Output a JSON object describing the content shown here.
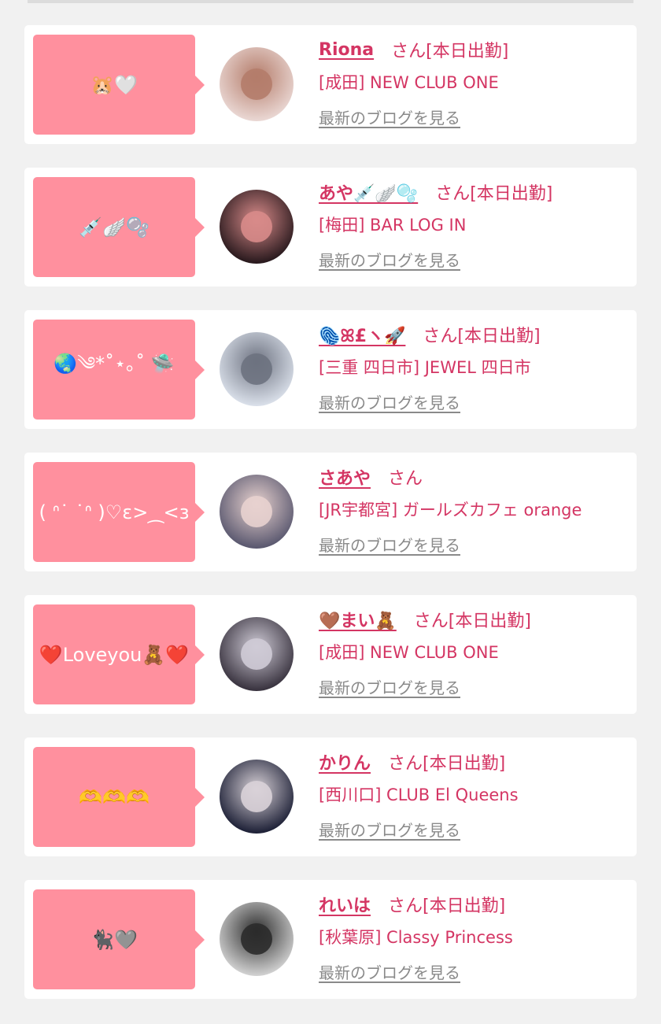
{
  "entries": [
    {
      "message": "🐹🤍",
      "name": "Riona",
      "suffix": "さん[本日出勤]",
      "shop": "[成田] NEW CLUB ONE",
      "blog_link": "最新のブログを見る",
      "avatar_colors": [
        "#e9d6d2",
        "#b47c6a"
      ]
    },
    {
      "message": "💉🪽🫧",
      "name": "あや💉🪽🫧",
      "suffix": "さん[本日出勤]",
      "shop": "[梅田] BAR LOG IN",
      "blog_link": "最新のブログを見る",
      "avatar_colors": [
        "#2a1a1e",
        "#d88b8a"
      ]
    },
    {
      "message": "🌏༄*˚⋆｡˚ 🛸",
      "name": "🫆ꕤ£ヽ🚀",
      "suffix": "さん[本日出勤]",
      "shop": "[三重 四日市] JEWEL 四日市",
      "blog_link": "最新のブログを見る",
      "avatar_colors": [
        "#d8dee8",
        "#6d7280"
      ]
    },
    {
      "message": "( ᐢ˙ ˙ᐢ )♡ɛ>⁔<з",
      "name": "さあや",
      "suffix": "さん",
      "shop": "[JR宇都宮] ガールズカフェ orange",
      "blog_link": "最新のブログを見る",
      "avatar_colors": [
        "#5b5970",
        "#e8d2cf"
      ]
    },
    {
      "message": "❤️Loveyou🧸❤️",
      "name": "🤎まい🧸",
      "suffix": "さん[本日出勤]",
      "shop": "[成田] NEW CLUB ONE",
      "blog_link": "最新のブログを見る",
      "avatar_colors": [
        "#3a3440",
        "#cfcbd6"
      ]
    },
    {
      "message": "🫶🫶🫶",
      "name": "かりん",
      "suffix": "さん[本日出勤]",
      "shop": "[西川口] CLUB El Queens",
      "blog_link": "最新のブログを見る",
      "avatar_colors": [
        "#1f2238",
        "#d9d2d8"
      ]
    },
    {
      "message": "🐈‍⬛🩶",
      "name": "れいは",
      "suffix": "さん[本日出勤]",
      "shop": "[秋葉原] Classy Princess",
      "blog_link": "最新のブログを見る",
      "avatar_colors": [
        "#cfcfcf",
        "#2b2b2b"
      ]
    }
  ],
  "colors": {
    "accent": "#d43563",
    "bubble": "#ff909e",
    "background": "#f1f1f1",
    "link_gray": "#8a8a8a"
  }
}
